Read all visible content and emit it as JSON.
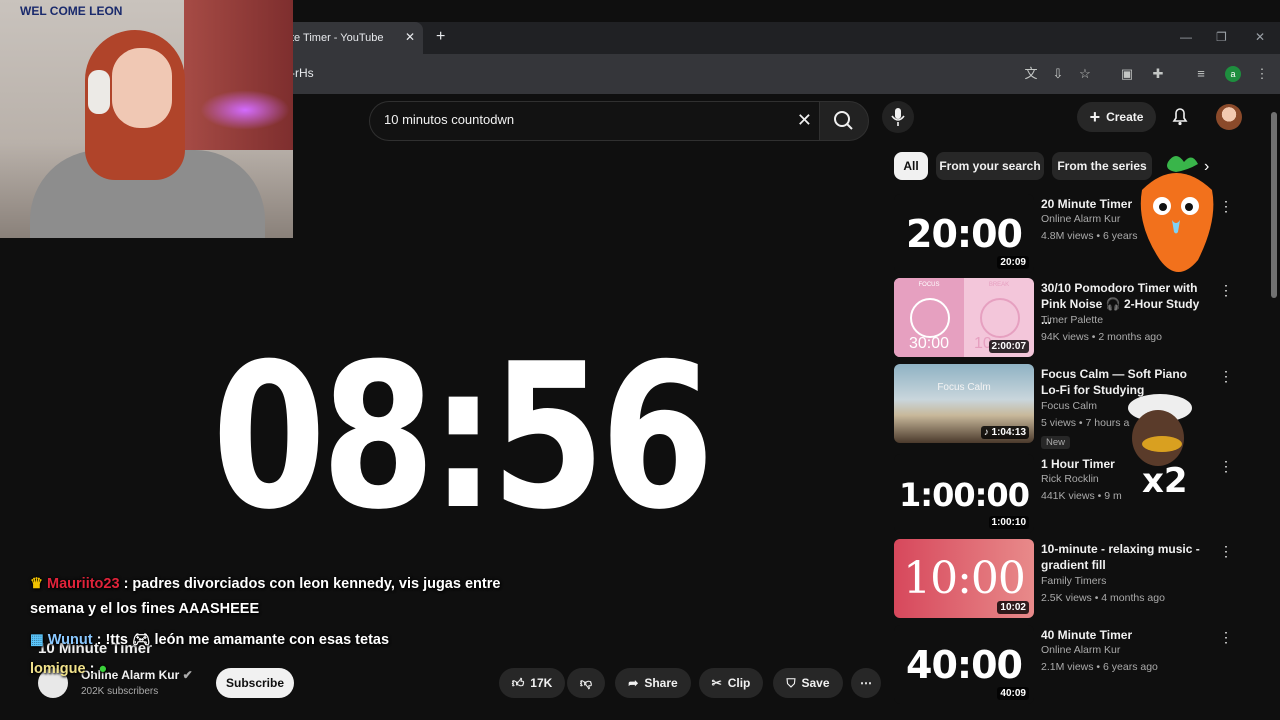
{
  "browser": {
    "tab_title": "te Timer - YouTube",
    "new_tab": "+",
    "url_fragment": "z-rHs",
    "profile_initial": "a"
  },
  "youtube": {
    "search_query": "10 minutos countodwn",
    "create_label": "Create",
    "chips": [
      "All",
      "From your search",
      "From the series"
    ],
    "player": {
      "time_display": "08:56"
    },
    "video": {
      "title": "10 Minute Timer",
      "channel": "Online Alarm Kur",
      "subscribers": "202K subscribers",
      "subscribe_label": "Subscribe",
      "likes": "17K",
      "share_label": "Share",
      "clip_label": "Clip",
      "save_label": "Save"
    },
    "recommendations": [
      {
        "thumb_text": "20:00",
        "duration": "20:09",
        "title": "20 Minute Timer",
        "channel": "Online Alarm Kur",
        "meta": "4.8M views • 6 years",
        "thumb_bg": "#0f0f0f"
      },
      {
        "thumb_text": "",
        "duration": "2:00:07",
        "title": "30/10 Pomodoro Timer with Pink Noise 🎧 2-Hour Study ...",
        "channel": "Timer Palette",
        "meta": "94K views • 2 months ago",
        "thumb_bg": "#e8a5c4",
        "focus_label": "FOCUS",
        "break_label": "BREAK",
        "focus_time": "30:00",
        "break_time": "10"
      },
      {
        "thumb_text": "Focus Calm",
        "duration": "1:04:13",
        "title": "Focus Calm — Soft Piano Lo-Fi for Studying",
        "channel": "Focus Calm",
        "meta": "5 views • 7 hours a",
        "badge": "New",
        "thumb_bg": "#3a4a52"
      },
      {
        "thumb_text": "1:00:00",
        "duration": "1:00:10",
        "title": "1 Hour Timer",
        "channel": "Rick Rocklin",
        "meta": "441K views • 9 m",
        "thumb_bg": "#0f0f0f"
      },
      {
        "thumb_text": "10:00",
        "duration": "10:02",
        "title": "10-minute - relaxing music - gradient fill",
        "channel": "Family Timers",
        "meta": "2.5K views • 4 months ago",
        "thumb_bg": "#d9546a"
      },
      {
        "thumb_text": "40:00",
        "duration": "40:09",
        "title": "40 Minute Timer",
        "channel": "Online Alarm Kur",
        "meta": "2.1M views • 6 years ago",
        "thumb_bg": "#0f0f0f"
      }
    ]
  },
  "stream_overlay": {
    "webcam_label": "WEL COME LEON",
    "chat": [
      {
        "user": "Mauriito23",
        "text": ": padres divorciados con leon kennedy, vis jugas entre",
        "text2": "semana y el los fines AAASHEEE"
      },
      {
        "user": "Wunut",
        "text": ": !tts",
        "text2": "león me amamante con esas tetas"
      },
      {
        "user": "lomigue",
        "text": ":"
      }
    ],
    "duck_multiplier": "x2"
  },
  "colors": {
    "youtube_bg": "#0f0f0f",
    "chip_bg": "#272727",
    "chat_user_red": "#e0233a"
  }
}
